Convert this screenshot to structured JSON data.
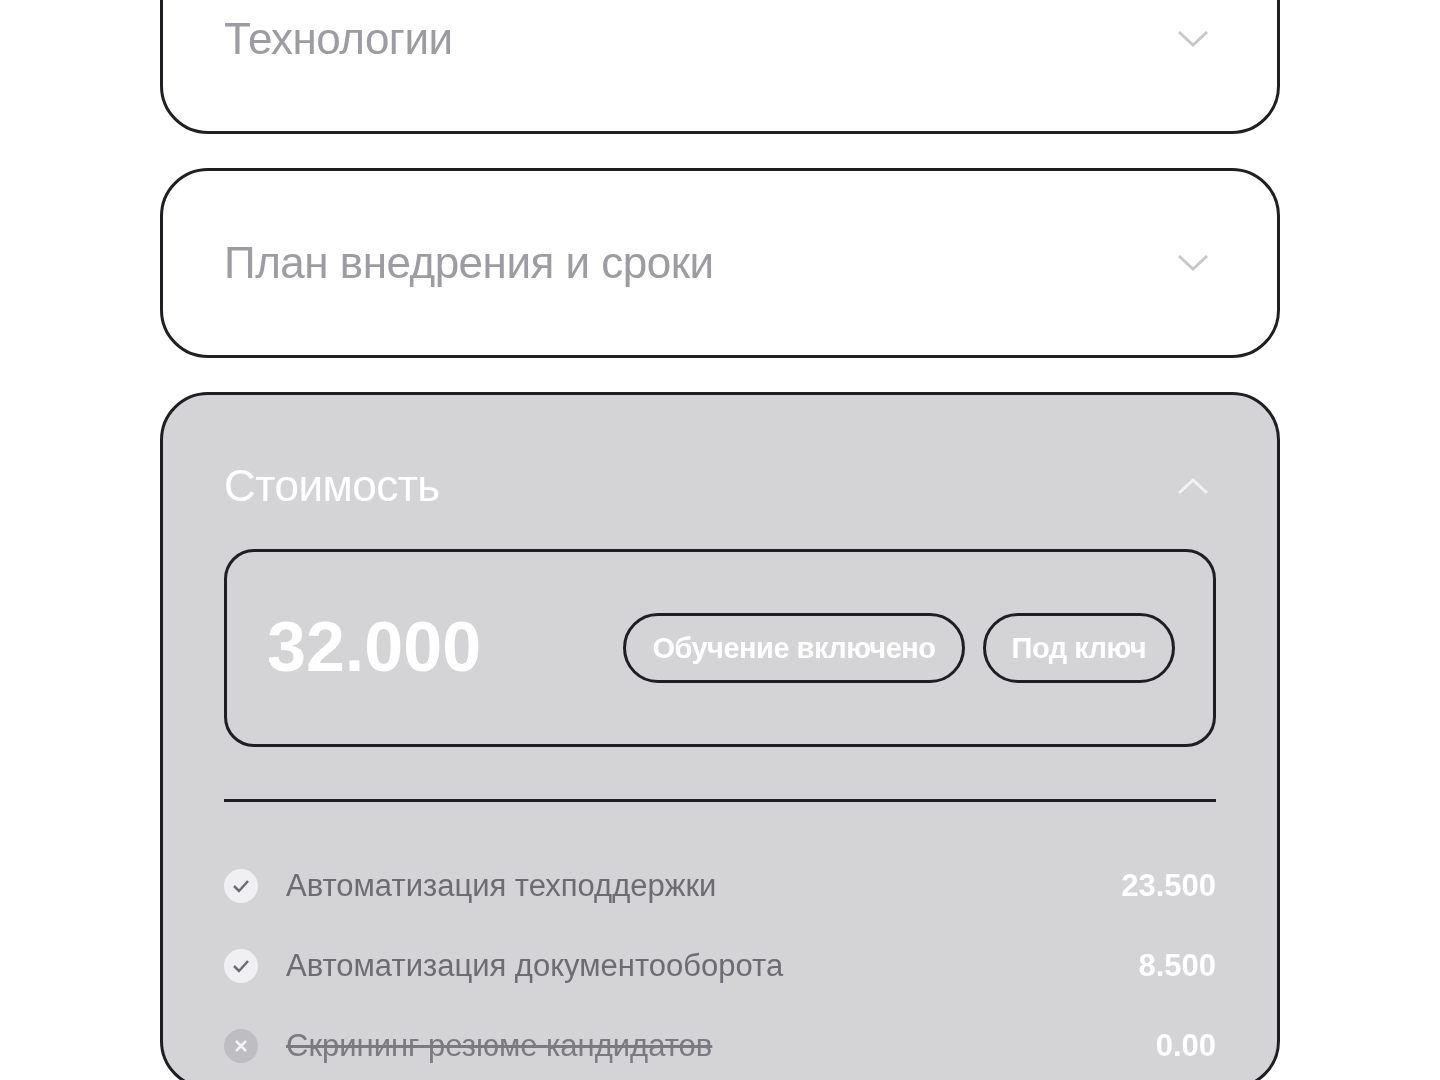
{
  "sections": [
    {
      "title": "Технологии",
      "expanded": false
    },
    {
      "title": "План внедрения и сроки",
      "expanded": false
    },
    {
      "title": "Стоимость",
      "expanded": true,
      "price": {
        "amount": "32.000",
        "tags": [
          "Обучение включено",
          "Под ключ"
        ]
      },
      "items": [
        {
          "label": "Автоматизация техподдержки",
          "price": "23.500",
          "included": true
        },
        {
          "label": "Автоматизация документооборота",
          "price": "8.500",
          "included": true
        },
        {
          "label": "Скрининг резюме кандидатов",
          "price": "0.00",
          "included": false
        }
      ]
    }
  ]
}
